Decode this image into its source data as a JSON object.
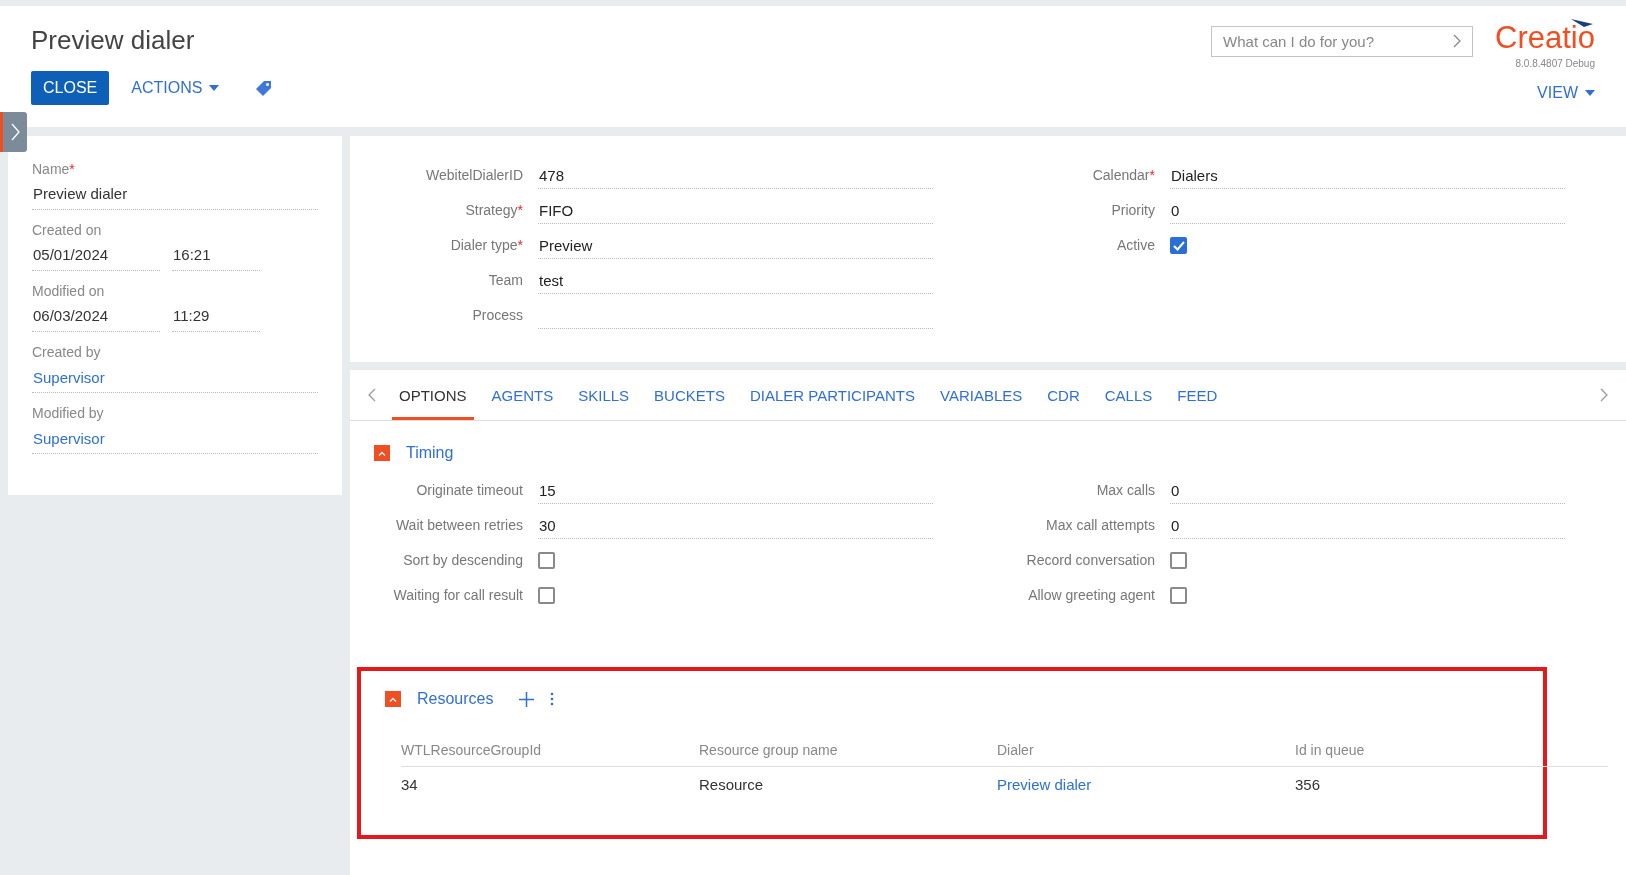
{
  "header": {
    "title": "Preview dialer",
    "close_button": "CLOSE",
    "actions_button": "ACTIONS",
    "search": {
      "placeholder": "What can I do for you?"
    },
    "logo": "Creatio",
    "version": "8.0.8.4807 Debug",
    "view_button": "VIEW"
  },
  "profile": [
    {
      "label": "Name",
      "required_mark": "*",
      "kind": "text",
      "value": "Preview dialer"
    },
    {
      "label": "Created on",
      "kind": "datetime",
      "date": "05/01/2024",
      "time": "16:21"
    },
    {
      "label": "Modified on",
      "kind": "datetime",
      "date": "06/03/2024",
      "time": "11:29"
    },
    {
      "label": "Created by",
      "kind": "link",
      "value": "Supervisor"
    },
    {
      "label": "Modified by",
      "kind": "link",
      "value": "Supervisor"
    }
  ],
  "main_fields": {
    "left": [
      {
        "label": "WebitelDialerID",
        "kind": "text",
        "value": "478"
      },
      {
        "label": "Strategy",
        "required_mark": "*",
        "kind": "text",
        "value": "FIFO"
      },
      {
        "label": "Dialer type",
        "required_mark": "*",
        "kind": "text",
        "value": "Preview"
      },
      {
        "label": "Team",
        "kind": "text",
        "value": "test"
      },
      {
        "label": "Process",
        "kind": "text"
      }
    ],
    "right": [
      {
        "label": "Calendar",
        "required_mark": "*",
        "kind": "text",
        "value": "Dialers"
      },
      {
        "label": "Priority",
        "kind": "text",
        "value": "0"
      },
      {
        "label": "Active",
        "kind": "checkbox",
        "checked": true
      }
    ]
  },
  "tabs": [
    {
      "label": "OPTIONS",
      "selected": true
    },
    {
      "label": "AGENTS",
      "selected": false
    },
    {
      "label": "SKILLS",
      "selected": false
    },
    {
      "label": "BUCKETS",
      "selected": false
    },
    {
      "label": "DIALER PARTICIPANTS",
      "selected": false
    },
    {
      "label": "VARIABLES",
      "selected": false
    },
    {
      "label": "CDR",
      "selected": false
    },
    {
      "label": "CALLS",
      "selected": false
    },
    {
      "label": "FEED",
      "selected": false
    }
  ],
  "timing": {
    "title": "Timing",
    "expanded": true,
    "left": [
      {
        "label": "Originate timeout",
        "kind": "text",
        "value": "15"
      },
      {
        "label": "Wait between retries",
        "kind": "text",
        "value": "30"
      },
      {
        "label": "Sort by descending",
        "kind": "checkbox",
        "checked": false
      },
      {
        "label": "Waiting for call result",
        "kind": "checkbox",
        "checked": false
      }
    ],
    "right": [
      {
        "label": "Max calls",
        "kind": "text",
        "value": "0"
      },
      {
        "label": "Max call attempts",
        "kind": "text",
        "value": "0"
      },
      {
        "label": "Record conversation",
        "kind": "checkbox",
        "checked": false
      },
      {
        "label": "Allow greeting agent",
        "kind": "checkbox",
        "checked": false
      }
    ]
  },
  "resources": {
    "title": "Resources",
    "expanded": true,
    "highlighted": true,
    "columns": [
      "WTLResourceGroupId",
      "Resource group name",
      "Dialer",
      "Id in queue"
    ],
    "rows": [
      {
        "cells": [
          {
            "kind": "text",
            "text": "34"
          },
          {
            "kind": "text",
            "text": "Resource"
          },
          {
            "kind": "link",
            "text": "Preview dialer"
          },
          {
            "kind": "text",
            "text": "356"
          }
        ]
      }
    ]
  }
}
